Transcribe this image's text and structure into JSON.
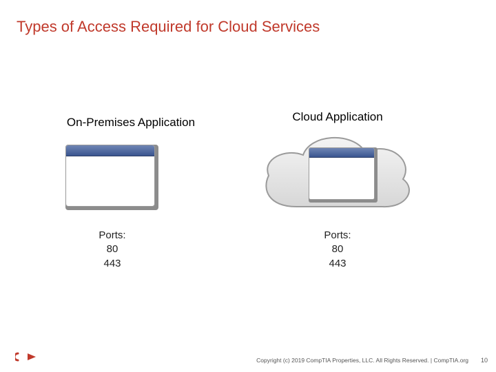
{
  "title": {
    "text": "Types of Access Required for Cloud Services",
    "color": "#c0392b"
  },
  "columns": {
    "onprem": {
      "heading": "On-Premises Application",
      "ports_label": "Ports:",
      "ports": [
        "80",
        "443"
      ]
    },
    "cloud": {
      "heading": "Cloud Application",
      "ports_label": "Ports:",
      "ports": [
        "80",
        "443"
      ]
    }
  },
  "footer": {
    "copyright": "Copyright (c) 2019 CompTIA Properties, LLC. All Rights Reserved.  |  CompTIA.org",
    "page_number": "10"
  },
  "brand": {
    "accent": "#c0392b"
  }
}
